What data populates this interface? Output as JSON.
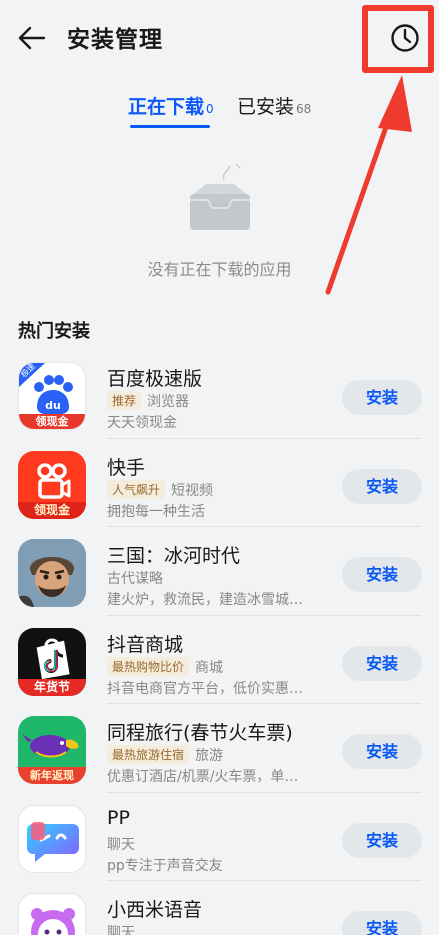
{
  "header": {
    "title": "安装管理"
  },
  "tabs": [
    {
      "label": "正在下载",
      "count": "0"
    },
    {
      "label": "已安装",
      "count": "68"
    }
  ],
  "empty": {
    "message": "没有正在下载的应用"
  },
  "section": {
    "title": "热门安装"
  },
  "install_label": "安装",
  "apps": [
    {
      "name": "百度极速版",
      "tag": "推荐",
      "category": "浏览器",
      "desc": "天天领现金",
      "badge": "极速",
      "banner": "领现金",
      "icon": "baidu-lite-icon"
    },
    {
      "name": "快手",
      "tag": "人气飙升",
      "category": "短视频",
      "desc": "拥抱每一种生活",
      "banner": "领现金",
      "icon": "kuaishou-icon"
    },
    {
      "name": "三国：冰河时代",
      "tag": "",
      "category": "古代谋略",
      "desc": "建火炉，救流民，建造冰雪城…",
      "icon": "sanguo-icon"
    },
    {
      "name": "抖音商城",
      "tag": "最热购物比价",
      "category": "商城",
      "desc": "抖音电商官方平台，低价实惠…",
      "banner": "年货节",
      "icon": "douyin-mall-icon"
    },
    {
      "name": "同程旅行(春节火车票)",
      "tag": "最热旅游住宿",
      "category": "旅游",
      "desc": "优惠订酒店/机票/火车票，单…",
      "banner": "新年返现",
      "icon": "tongcheng-icon"
    },
    {
      "name": "PP",
      "tag": "",
      "category": "聊天",
      "desc": "pp专注于声音交友",
      "icon": "pp-icon"
    },
    {
      "name": "小西米语音",
      "tag": "",
      "category": "聊天",
      "desc": "",
      "icon": "xiaoximi-icon"
    }
  ],
  "colors": {
    "accent": "#0a59f7",
    "highlight": "#ee3b2e"
  }
}
